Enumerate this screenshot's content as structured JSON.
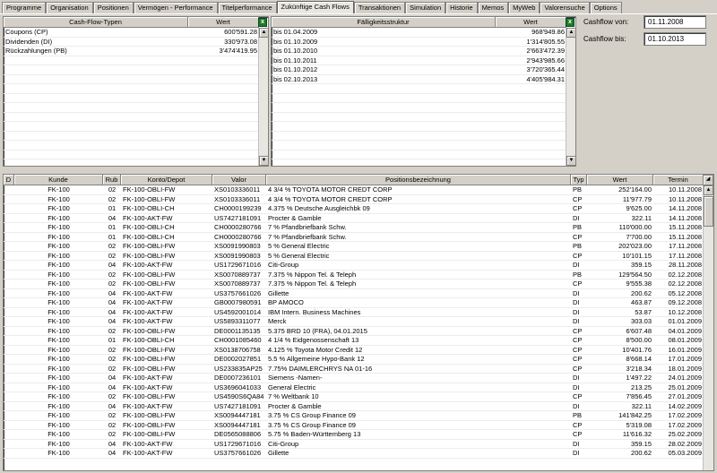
{
  "tabs": [
    {
      "label": "Programme",
      "active": false
    },
    {
      "label": "Organisation",
      "active": false
    },
    {
      "label": "Positionen",
      "active": false
    },
    {
      "label": "Vermögen - Performance",
      "active": false
    },
    {
      "label": "Titelperformance",
      "active": false
    },
    {
      "label": "Zukünftige Cash Flows",
      "active": true
    },
    {
      "label": "Transaktionen",
      "active": false
    },
    {
      "label": "Simulation",
      "active": false
    },
    {
      "label": "Historie",
      "active": false
    },
    {
      "label": "Memos",
      "active": false
    },
    {
      "label": "MyWeb",
      "active": false
    },
    {
      "label": "Valorensuche",
      "active": false
    },
    {
      "label": "Options",
      "active": false
    }
  ],
  "cashflow_types": {
    "headers": {
      "type": "Cash-Flow-Typen",
      "value": "Wert"
    },
    "rows": [
      {
        "type": "Coupons (CP)",
        "value": "600'591.28"
      },
      {
        "type": "Dividenden (DI)",
        "value": "330'973.08"
      },
      {
        "type": "Rückzahlungen (PB)",
        "value": "3'474'419.95"
      }
    ]
  },
  "maturity": {
    "headers": {
      "label": "Fälligkeitsstruktur",
      "value": "Wert"
    },
    "rows": [
      {
        "label": "bis 01.04.2009",
        "value": "968'949.86"
      },
      {
        "label": "bis 01.10.2009",
        "value": "1'314'805.55"
      },
      {
        "label": "bis 01.10.2010",
        "value": "2'663'472.39"
      },
      {
        "label": "bis 01.10.2011",
        "value": "2'943'985.66"
      },
      {
        "label": "bis 01.10.2012",
        "value": "3'720'365.44"
      },
      {
        "label": "bis 02.10.2013",
        "value": "4'405'984.31"
      }
    ]
  },
  "form": {
    "from_label": "Cashflow von:",
    "from_value": "01.11.2008",
    "to_label": "Cashflow bis:",
    "to_value": "01.10.2013"
  },
  "main_table": {
    "headers": [
      "D",
      "Kunde",
      "Rub",
      "Konto/Depot",
      "Valor",
      "Positionsbezeichnung",
      "Typ",
      "Wert",
      "Termin"
    ],
    "rows": [
      [
        "",
        "FK-100",
        "02",
        "FK-100-OBLI-FW",
        "XS0103336011",
        "4 3/4 %  TOYOTA MOTOR CREDT CORP",
        "PB",
        "252'164.00",
        "10.11.2008"
      ],
      [
        "",
        "FK-100",
        "02",
        "FK-100-OBLI-FW",
        "XS0103336011",
        "4 3/4 %  TOYOTA MOTOR CREDT CORP",
        "CP",
        "11'977.79",
        "10.11.2008"
      ],
      [
        "",
        "FK-100",
        "01",
        "FK-100-OBLI-CH",
        "CH0000199239",
        "4.375 %  Deutsche Ausgleichbk 09",
        "CP",
        "9'625.00",
        "14.11.2008"
      ],
      [
        "",
        "FK-100",
        "04",
        "FK-100-AKT-FW",
        "US7427181091",
        "Procter & Gamble",
        "DI",
        "322.11",
        "14.11.2008"
      ],
      [
        "",
        "FK-100",
        "01",
        "FK-100-OBLI-CH",
        "CH0000280766",
        "7   %   Pfandbriefbank Schw.",
        "PB",
        "110'000.00",
        "15.11.2008"
      ],
      [
        "",
        "FK-100",
        "01",
        "FK-100-OBLI-CH",
        "CH0000280766",
        "7   %   Pfandbriefbank Schw.",
        "CP",
        "7'700.00",
        "15.11.2008"
      ],
      [
        "",
        "FK-100",
        "02",
        "FK-100-OBLI-FW",
        "XS0091990803",
        "5   %   General Electric",
        "PB",
        "202'023.00",
        "17.11.2008"
      ],
      [
        "",
        "FK-100",
        "02",
        "FK-100-OBLI-FW",
        "XS0091990803",
        "5   %   General Electric",
        "CP",
        "10'101.15",
        "17.11.2008"
      ],
      [
        "",
        "FK-100",
        "04",
        "FK-100-AKT-FW",
        "US1729671016",
        "Citi-Group",
        "DI",
        "359.15",
        "28.11.2008"
      ],
      [
        "",
        "FK-100",
        "02",
        "FK-100-OBLI-FW",
        "XS0070889737",
        "7.375 %  Nippon Tel. & Teleph",
        "PB",
        "129'564.50",
        "02.12.2008"
      ],
      [
        "",
        "FK-100",
        "02",
        "FK-100-OBLI-FW",
        "XS0070889737",
        "7.375 %  Nippon Tel. & Teleph",
        "CP",
        "9'555.38",
        "02.12.2008"
      ],
      [
        "",
        "FK-100",
        "04",
        "FK-100-AKT-FW",
        "US3757661026",
        "Gillette",
        "DI",
        "200.62",
        "05.12.2008"
      ],
      [
        "",
        "FK-100",
        "04",
        "FK-100-AKT-FW",
        "GB0007980591",
        "BP AMOCO",
        "DI",
        "463.87",
        "09.12.2008"
      ],
      [
        "",
        "FK-100",
        "04",
        "FK-100-AKT-FW",
        "US4592001014",
        "IBM Intern. Business Machines",
        "DI",
        "53.87",
        "10.12.2008"
      ],
      [
        "",
        "FK-100",
        "04",
        "FK-100-AKT-FW",
        "US5893311077",
        "Merck",
        "DI",
        "303.03",
        "01.01.2009"
      ],
      [
        "",
        "FK-100",
        "02",
        "FK-100-OBLI-FW",
        "DE0001135135",
        "5.375 BRD 10 (FRA), 04.01.2015",
        "CP",
        "6'607.48",
        "04.01.2009"
      ],
      [
        "",
        "FK-100",
        "01",
        "FK-100-OBLI-CH",
        "CH0001085460",
        "4 1/4 %  Eidgenossenschaft 13",
        "CP",
        "8'500.00",
        "08.01.2009"
      ],
      [
        "",
        "FK-100",
        "02",
        "FK-100-OBLI-FW",
        "XS0138706758",
        "4.125 %  Toyota Motor Credit 12",
        "CP",
        "10'401.76",
        "16.01.2009"
      ],
      [
        "",
        "FK-100",
        "02",
        "FK-100-OBLI-FW",
        "DE0002027851",
        "5.5  %   Allgemeine Hypo-Bank 12",
        "CP",
        "8'668.14",
        "17.01.2009"
      ],
      [
        "",
        "FK-100",
        "02",
        "FK-100-OBLI-FW",
        "US233835AP25",
        "7.75% DAIMLERCHRYS NA 01-16",
        "CP",
        "3'218.34",
        "18.01.2009"
      ],
      [
        "",
        "FK-100",
        "04",
        "FK-100-AKT-FW",
        "DE0007236101",
        "Siemens  -Namen-",
        "DI",
        "1'497.22",
        "24.01.2009"
      ],
      [
        "",
        "FK-100",
        "04",
        "FK-100-AKT-FW",
        "US3696041033",
        "General Electric",
        "DI",
        "213.25",
        "25.01.2009"
      ],
      [
        "",
        "FK-100",
        "02",
        "FK-100-OBLI-FW",
        "US4590S6QA84",
        "7   %  Weltbank 10",
        "CP",
        "7'856.45",
        "27.01.2009"
      ],
      [
        "",
        "FK-100",
        "04",
        "FK-100-AKT-FW",
        "US7427181091",
        "Procter & Gamble",
        "DI",
        "322.11",
        "14.02.2009"
      ],
      [
        "",
        "FK-100",
        "02",
        "FK-100-OBLI-FW",
        "XS0094447181",
        "3.75 %   CS Group Finance 09",
        "PB",
        "141'842.25",
        "17.02.2009"
      ],
      [
        "",
        "FK-100",
        "02",
        "FK-100-OBLI-FW",
        "XS0094447181",
        "3.75 %   CS Group Finance 09",
        "CP",
        "5'319.08",
        "17.02.2009"
      ],
      [
        "",
        "FK-100",
        "02",
        "FK-100-OBLI-FW",
        "DE0565088806",
        "5.75  %  Baden-Württemberg 13",
        "CP",
        "11'616.32",
        "25.02.2009"
      ],
      [
        "",
        "FK-100",
        "04",
        "FK-100-AKT-FW",
        "US1729671016",
        "Citi-Group",
        "DI",
        "359.15",
        "28.02.2009"
      ],
      [
        "",
        "FK-100",
        "04",
        "FK-100-AKT-FW",
        "US3757661026",
        "Gillette",
        "DI",
        "200.62",
        "05.03.2009"
      ]
    ]
  },
  "icons": {
    "export_excel": "excel-export-icon",
    "scroll_up": "arrow-up-icon",
    "scroll_down": "arrow-down-icon",
    "corner_pin": "pin-icon"
  }
}
